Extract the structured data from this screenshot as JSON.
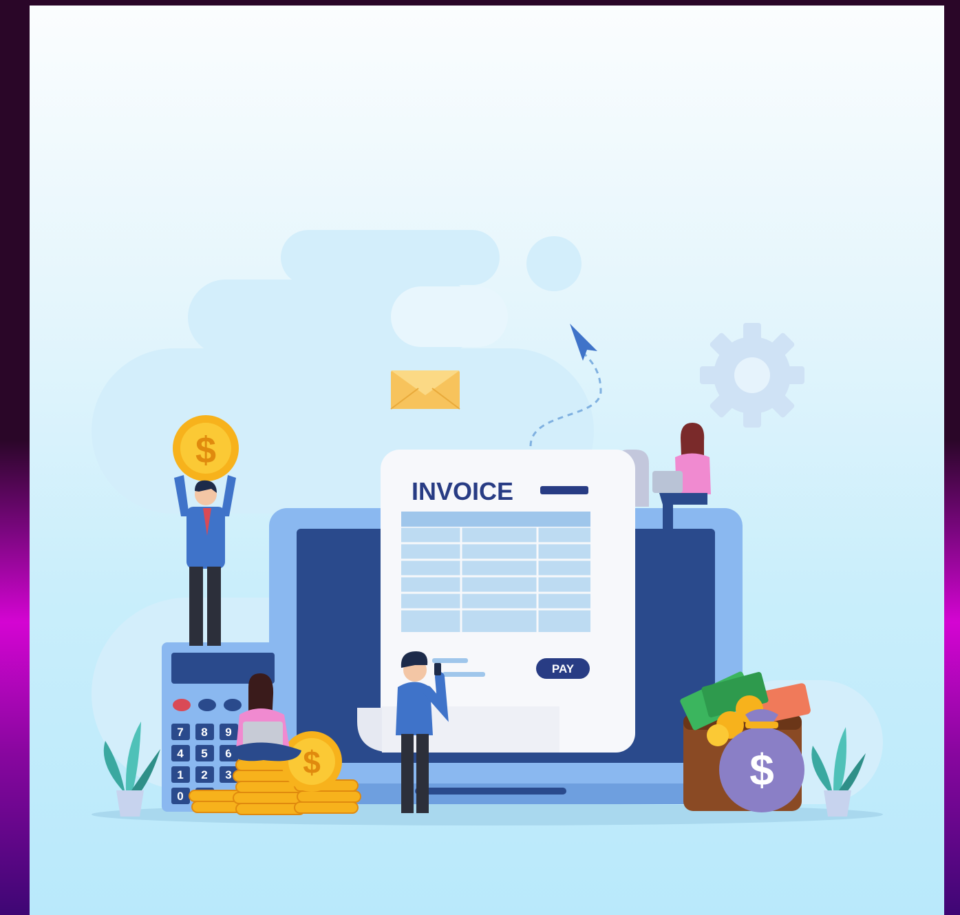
{
  "invoice": {
    "title": "INVOICE",
    "pay_label": "PAY"
  },
  "calculator": {
    "keys": [
      "7",
      "8",
      "9",
      "4",
      "5",
      "6",
      "1",
      "2",
      "3",
      "0"
    ]
  },
  "icons": {
    "envelope": "envelope-icon",
    "gear": "gear-icon",
    "cursor": "cursor-arrow-icon",
    "coin": "dollar-coin-icon",
    "money_bag": "money-bag-icon",
    "wallet": "wallet-icon",
    "plant": "potted-plant-icon"
  },
  "colors": {
    "frame_dark": "#2a0628",
    "frame_magenta": "#d405d2",
    "laptop_blue": "#8ab8f0",
    "screen_navy": "#2a4a8c",
    "invoice_navy": "#283c84",
    "coin_gold": "#f7b21c",
    "gear_blue": "#cfe2f5",
    "envelope_yellow": "#f7c35c"
  }
}
